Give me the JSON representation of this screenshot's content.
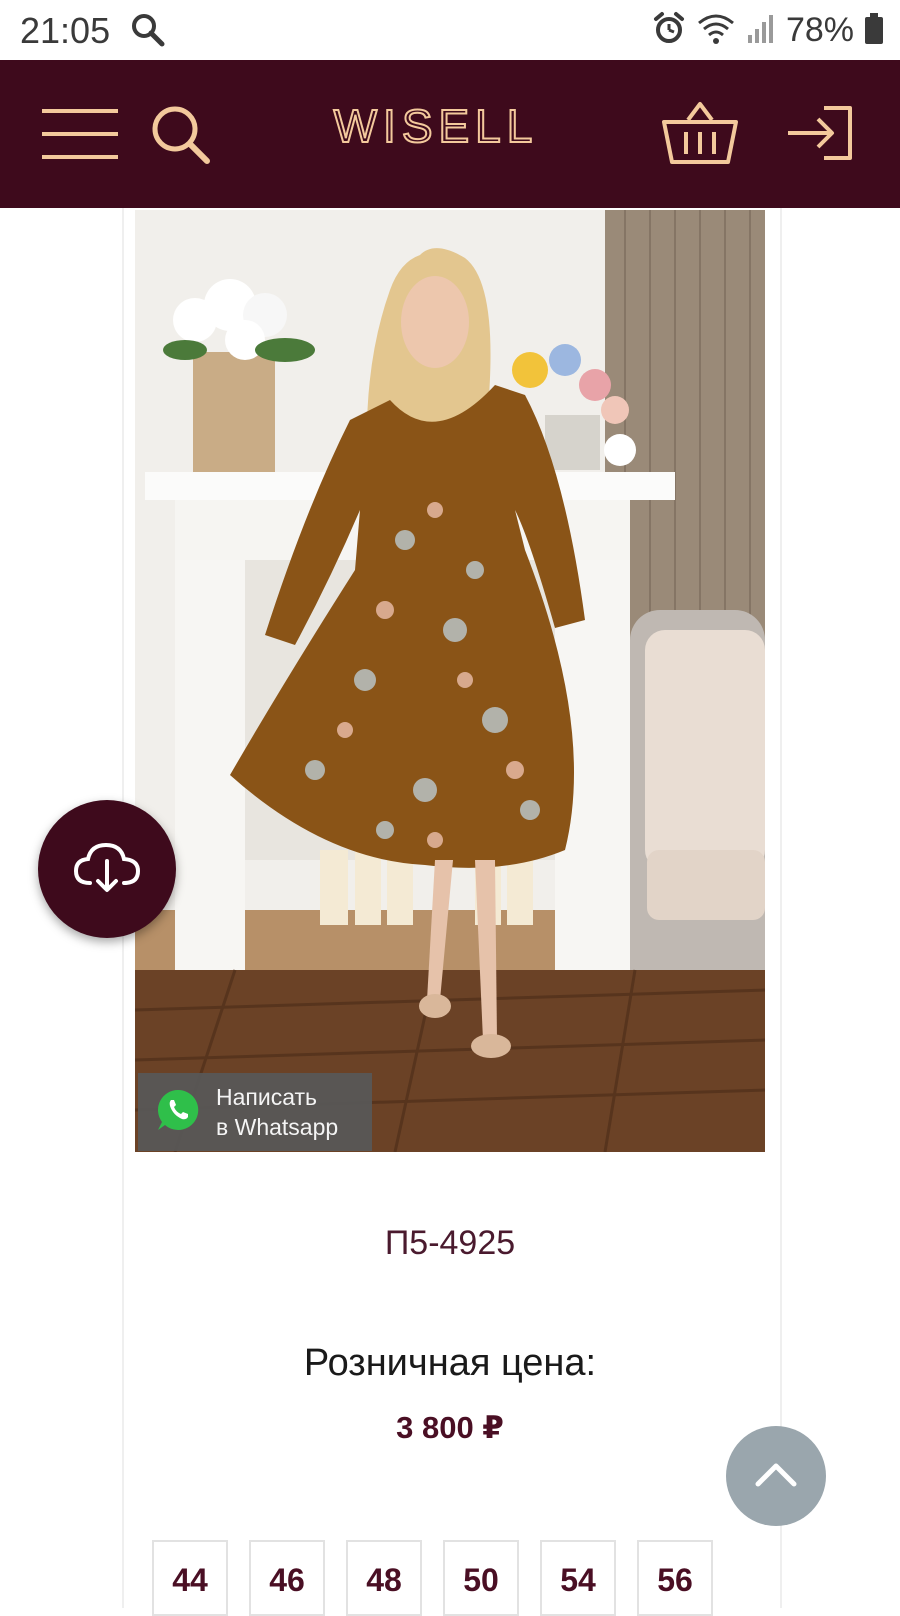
{
  "status_bar": {
    "time": "21:05",
    "battery_percent": "78%",
    "icons": [
      "search-icon",
      "alarm-icon",
      "wifi-icon",
      "signal-icon",
      "battery-icon"
    ]
  },
  "header": {
    "brand": "WISELL",
    "icons": [
      "menu-icon",
      "search-icon",
      "basket-icon",
      "login-icon"
    ],
    "background": "#3e0a1c",
    "accent": "#f3c99c"
  },
  "product": {
    "photo_icon": "product-photo",
    "whatsapp": {
      "line1": "Написать",
      "line2": "в Whatsapp",
      "icon": "whatsapp-icon"
    },
    "sku": "П5-4925",
    "price_label": "Розничная цена:",
    "price": "3 800 ₽",
    "sizes": [
      "44",
      "46",
      "48",
      "50",
      "54",
      "56"
    ]
  },
  "fabs": {
    "download_icon": "cloud-download-icon",
    "top_icon": "chevron-up-icon"
  }
}
